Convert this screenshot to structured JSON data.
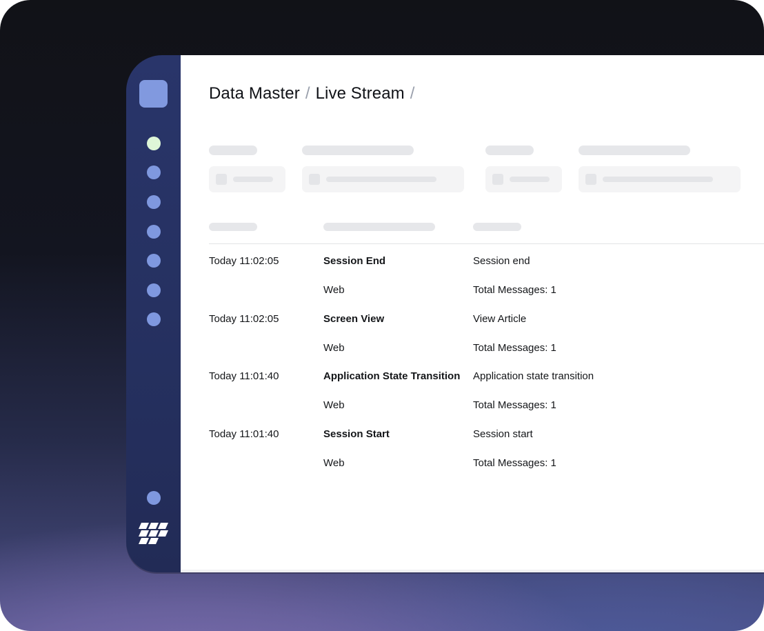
{
  "breadcrumb": {
    "items": [
      "Data Master",
      "Live Stream"
    ],
    "separator": "/"
  },
  "nav": {
    "items": [
      "nav-dot",
      "nav-dot",
      "nav-dot",
      "nav-dot",
      "nav-dot",
      "nav-dot",
      "nav-dot"
    ],
    "active_index": 0
  },
  "events": [
    {
      "time": "Today 11:02:05",
      "name": "Session End",
      "platform": "Web",
      "description": "Session end",
      "messages": "Total Messages: 1"
    },
    {
      "time": "Today 11:02:05",
      "name": "Screen View",
      "platform": "Web",
      "description": "View Article",
      "messages": "Total Messages: 1"
    },
    {
      "time": "Today 11:01:40",
      "name": "Application State Transition",
      "platform": "Web",
      "description": "Application state transition",
      "messages": "Total Messages: 1"
    },
    {
      "time": "Today 11:01:40",
      "name": "Session Start",
      "platform": "Web",
      "description": "Session start",
      "messages": "Total Messages: 1"
    }
  ],
  "colors": {
    "sidebar": "#29356a",
    "nav_dot": "#7f98df",
    "nav_dot_active": "#def6d8",
    "logo": "#8199df"
  },
  "icons": {
    "app_logo": "logo-square-icon",
    "brand": "brand-mark-icon",
    "settings": "settings-dot-icon"
  }
}
